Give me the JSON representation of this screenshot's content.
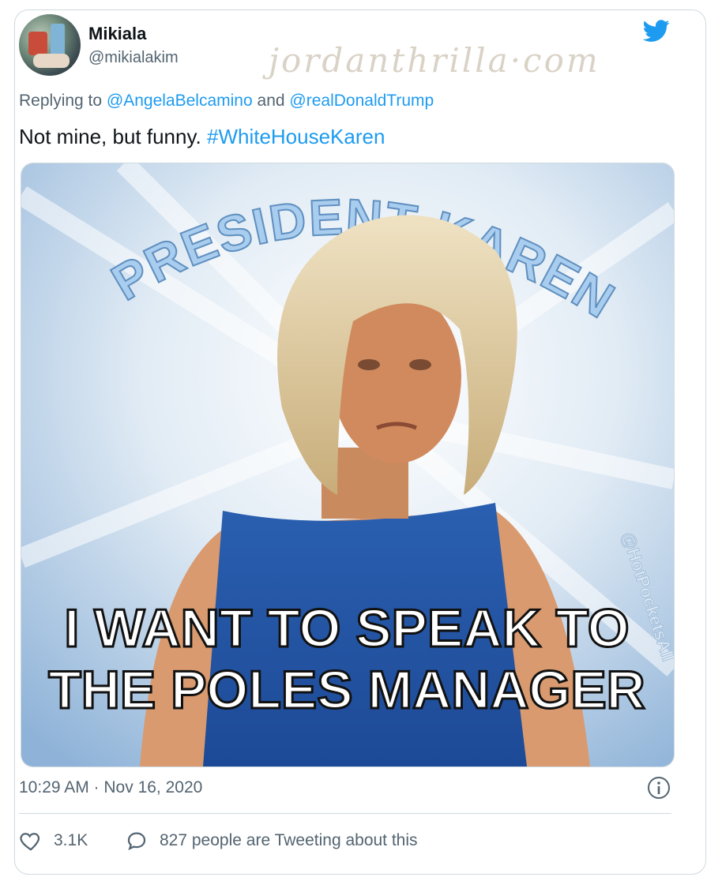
{
  "tweet": {
    "author_name": "Mikiala",
    "author_handle": "@mikialakim",
    "watermark": "jordanthrilla·com",
    "reply_prefix": "Replying to",
    "reply_user_1": "@AngelaBelcamino",
    "reply_and": "and",
    "reply_user_2": "@realDonaldTrump",
    "text": "Not mine, but funny.",
    "hashtag": "#WhiteHouseKaren",
    "timestamp": "10:29 AM · Nov 16, 2020",
    "likes": "3.1K",
    "conversation": "827 people are Tweeting about this"
  },
  "meme": {
    "arc_text": "PRESIDENT KAREN",
    "caption_line_1": "I WANT TO SPEAK TO",
    "caption_line_2": "THE POLES MANAGER",
    "credit": "@HotPocketsAll"
  },
  "icons": {
    "brand": "twitter-bird-icon",
    "info": "info-icon",
    "like": "heart-icon",
    "conversation": "comment-bubble-icon"
  },
  "colors": {
    "link": "#1d9bf0",
    "secondary_text": "#536471",
    "primary_text": "#0f1419",
    "border": "#cfd9de"
  }
}
